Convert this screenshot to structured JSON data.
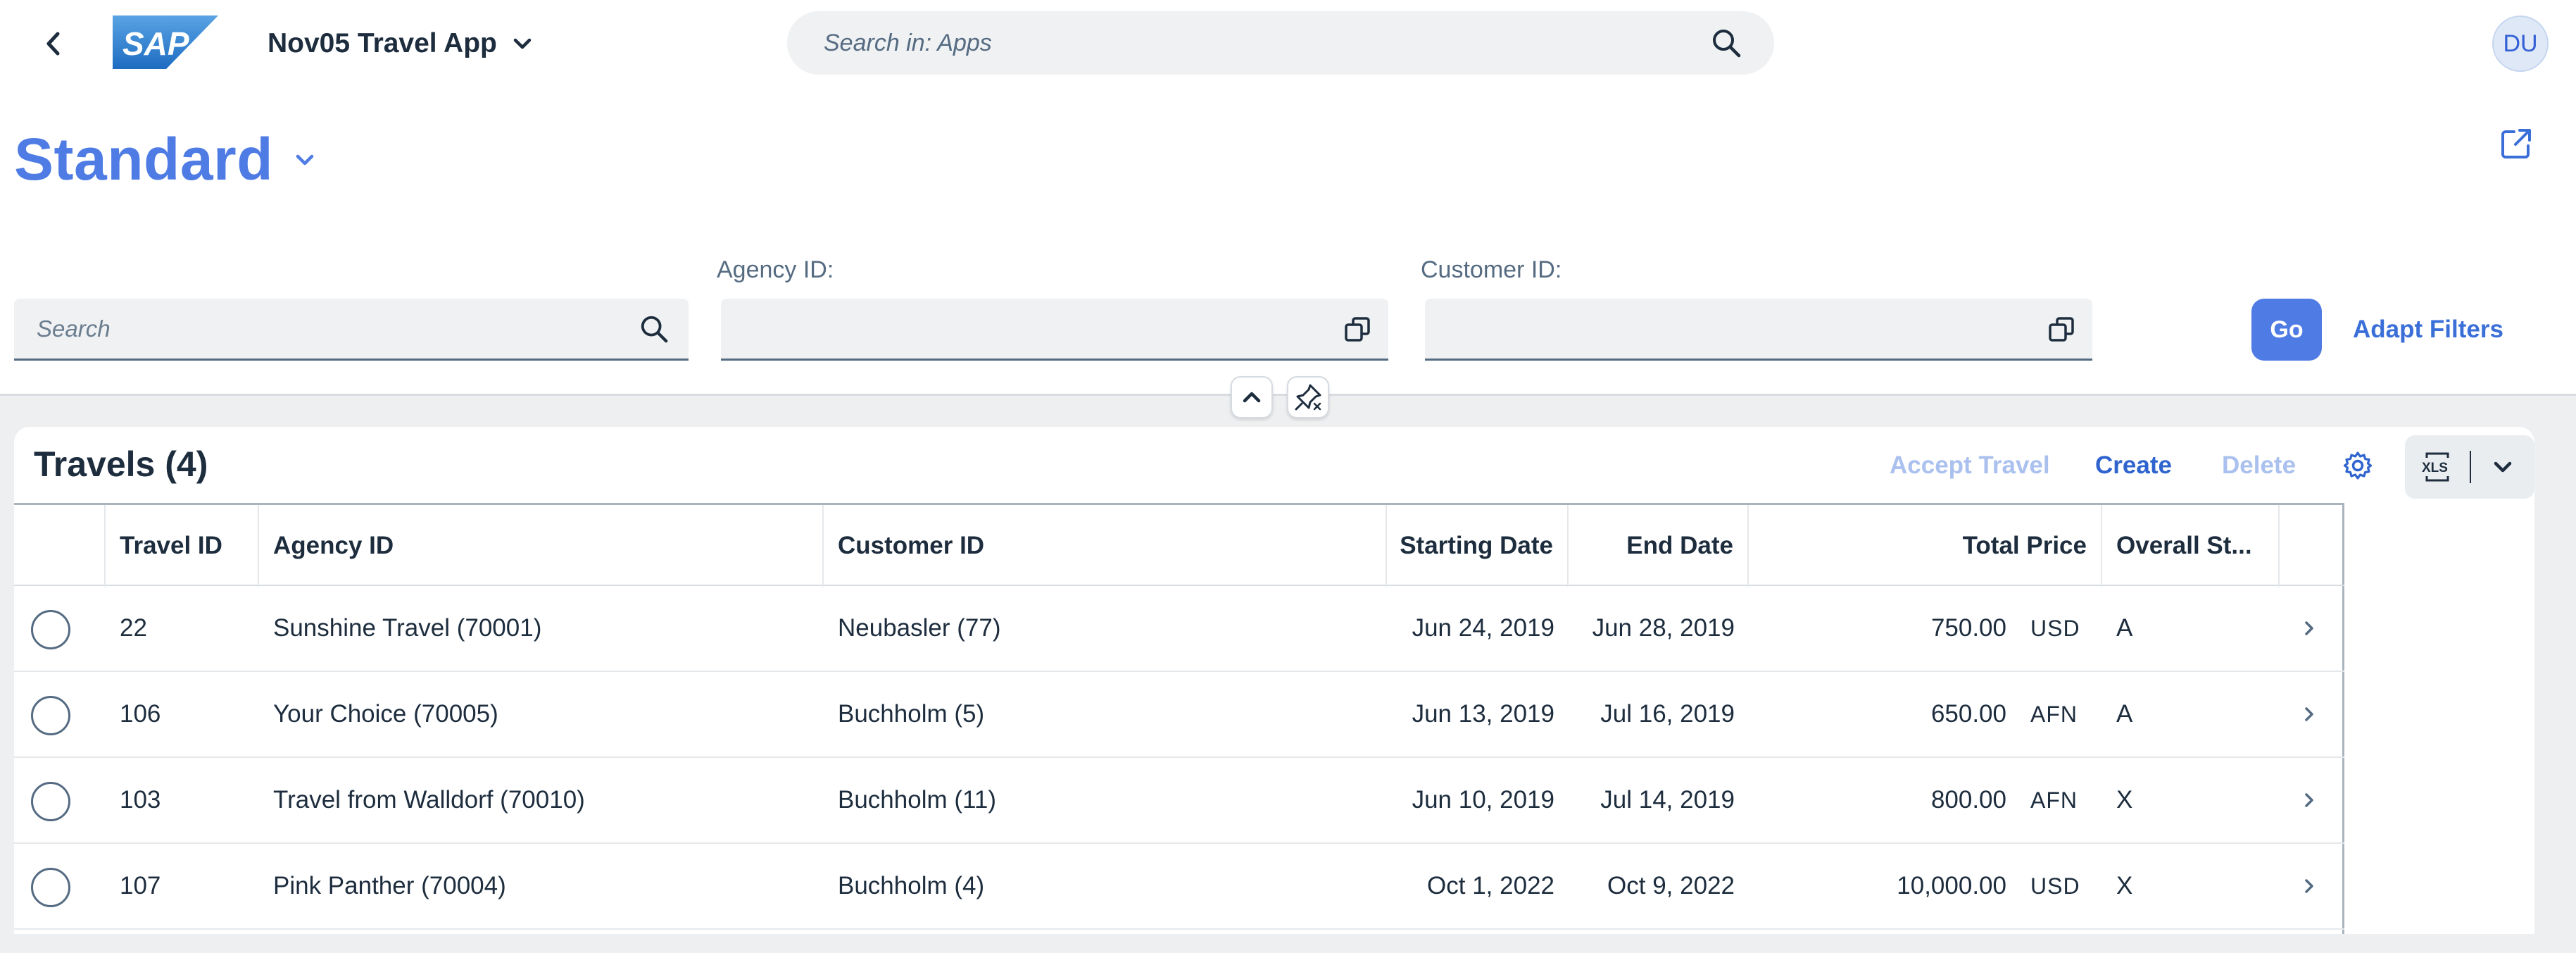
{
  "shell": {
    "app_title": "Nov05 Travel App",
    "logo_text": "SAP",
    "search_placeholder": "Search in: Apps",
    "avatar_initials": "DU"
  },
  "variant": {
    "title": "Standard"
  },
  "filter_bar": {
    "search_placeholder": "Search",
    "agency_label": "Agency ID:",
    "agency_value": "",
    "customer_label": "Customer ID:",
    "customer_value": "",
    "go_label": "Go",
    "adapt_label": "Adapt Filters"
  },
  "table": {
    "title": "Travels (4)",
    "actions": {
      "accept": "Accept Travel",
      "create": "Create",
      "delete": "Delete"
    },
    "columns": {
      "travel_id": "Travel ID",
      "agency_id": "Agency ID",
      "customer_id": "Customer ID",
      "start_date": "Starting Date",
      "end_date": "End Date",
      "total_price": "Total Price",
      "overall_status": "Overall St..."
    },
    "rows": [
      {
        "travel_id": "22",
        "agency": "Sunshine Travel (70001)",
        "customer": "Neubasler (77)",
        "start": "Jun 24, 2019",
        "end": "Jun 28, 2019",
        "price": "750.00",
        "currency": "USD",
        "status": "A"
      },
      {
        "travel_id": "106",
        "agency": "Your Choice (70005)",
        "customer": "Buchholm (5)",
        "start": "Jun 13, 2019",
        "end": "Jul 16, 2019",
        "price": "650.00",
        "currency": "AFN",
        "status": "A"
      },
      {
        "travel_id": "103",
        "agency": "Travel from Walldorf (70010)",
        "customer": "Buchholm (11)",
        "start": "Jun 10, 2019",
        "end": "Jul 14, 2019",
        "price": "800.00",
        "currency": "AFN",
        "status": "X"
      },
      {
        "travel_id": "107",
        "agency": "Pink Panther (70004)",
        "customer": "Buchholm (4)",
        "start": "Oct 1, 2022",
        "end": "Oct 9, 2022",
        "price": "10,000.00",
        "currency": "USD",
        "status": "X"
      }
    ]
  },
  "colors": {
    "brand": "#4f7ce4",
    "link": "#2f64cf",
    "disabled_link": "#aac0ee",
    "text": "#1d2d3e",
    "background": "#edeff0"
  },
  "icons": {
    "back": "chevron-left-icon",
    "search": "search-icon",
    "share": "share-icon",
    "value_help": "value-help-icon",
    "collapse": "chevron-up-icon",
    "unpin": "unpin-icon",
    "settings": "gear-icon",
    "export": "xls-export-icon",
    "dropdown": "chevron-down-icon",
    "navigation": "chevron-right-icon"
  }
}
